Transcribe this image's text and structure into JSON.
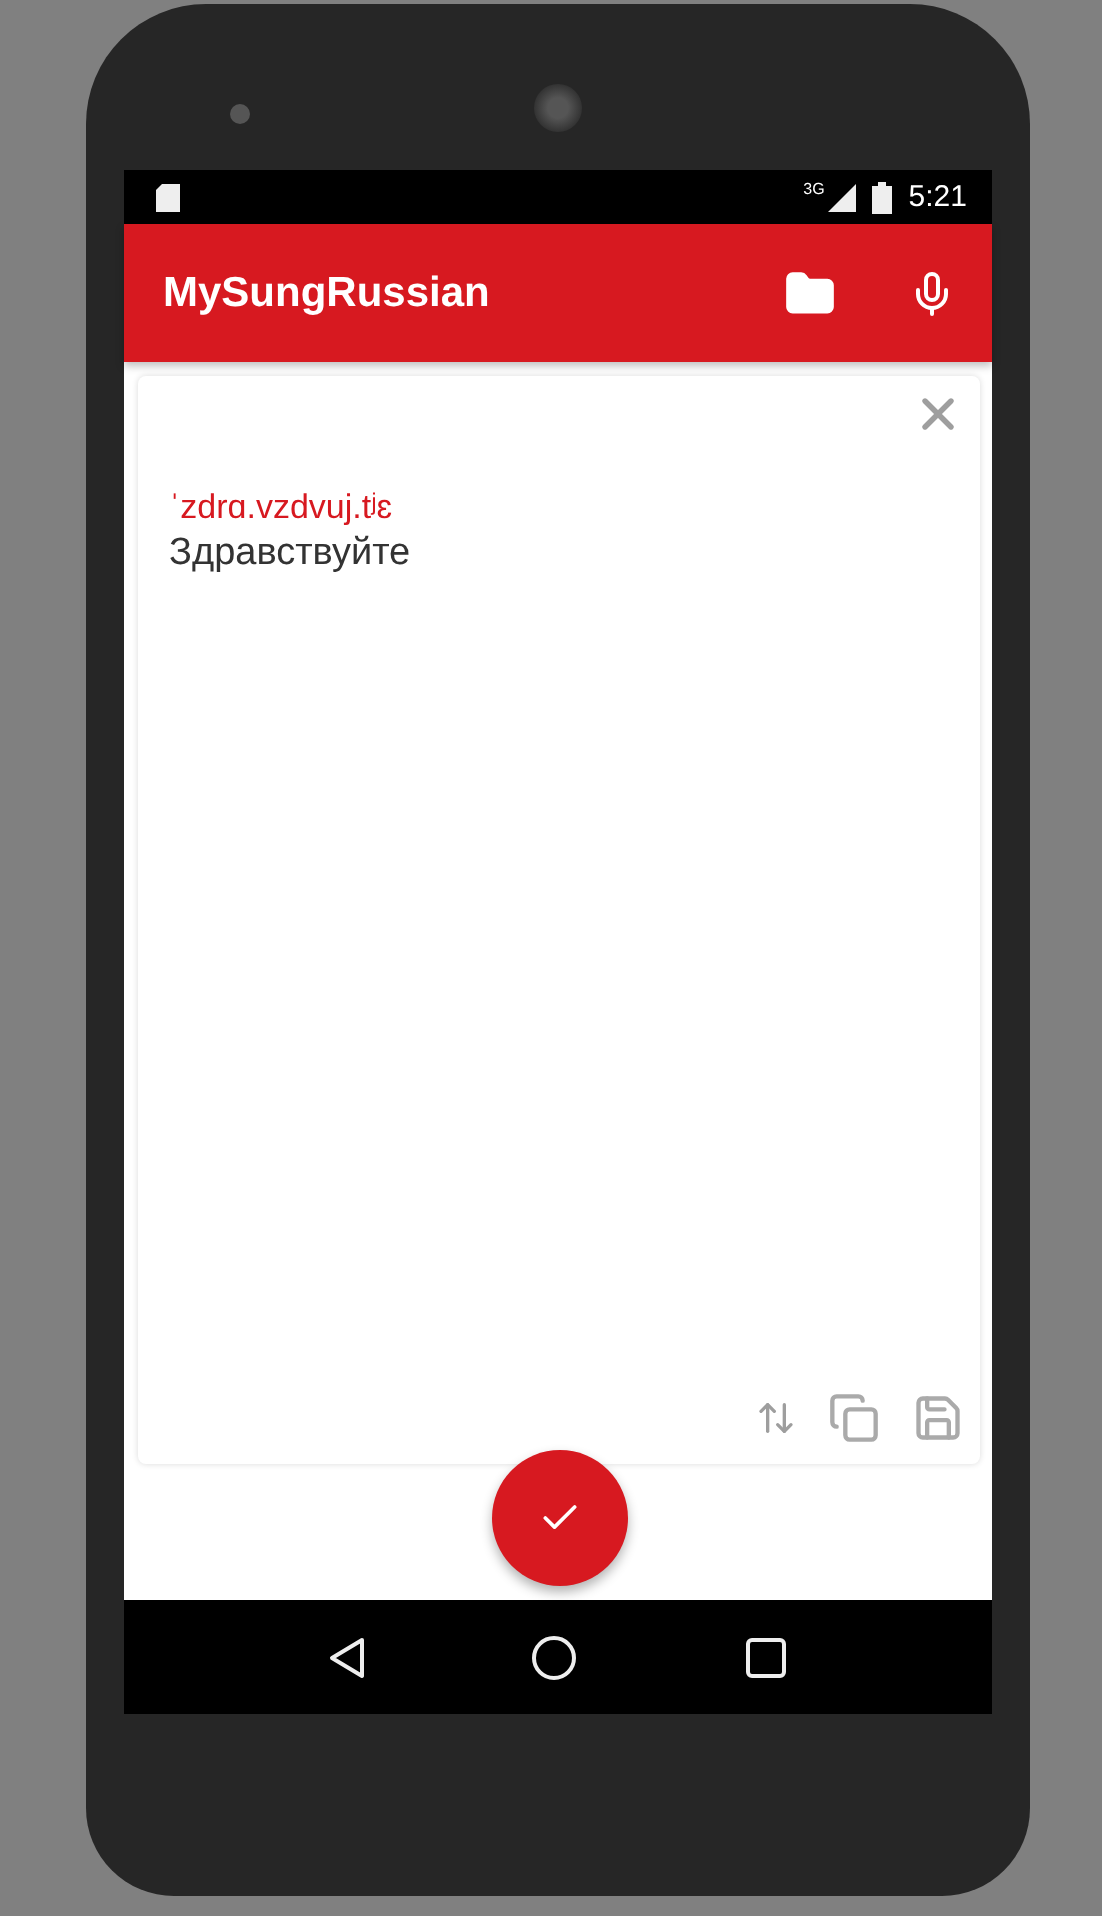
{
  "status_bar": {
    "network": "3G",
    "time": "5:21"
  },
  "app_bar": {
    "title": "MySungRussian"
  },
  "card": {
    "transcription": "ˈzdrɑ.vzdvuj.tʲɛ",
    "word": "Здравствуйте"
  }
}
